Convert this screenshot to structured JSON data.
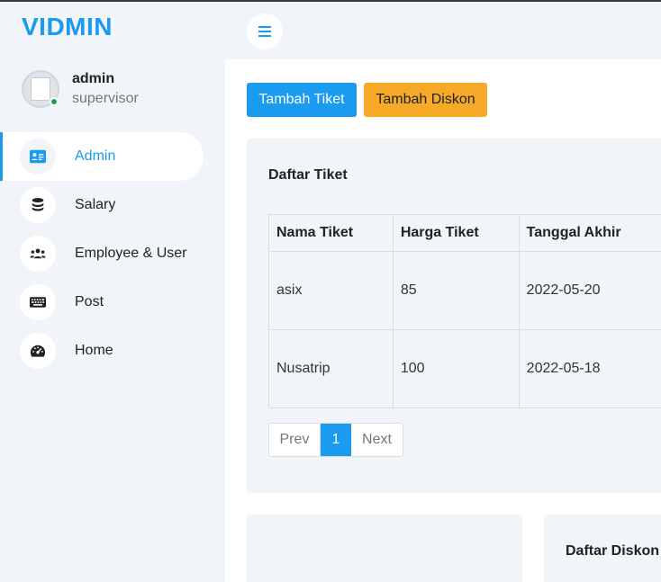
{
  "brand": "VIDMIN",
  "user": {
    "name": "admin",
    "role": "supervisor"
  },
  "sidebar": {
    "items": [
      {
        "label": "Admin",
        "icon": "id-card-icon",
        "active": true
      },
      {
        "label": "Salary",
        "icon": "coins-icon"
      },
      {
        "label": "Employee & User",
        "icon": "users-icon"
      },
      {
        "label": "Post",
        "icon": "keyboard-icon"
      },
      {
        "label": "Home",
        "icon": "dashboard-icon"
      }
    ]
  },
  "actions": {
    "add_ticket": "Tambah Tiket",
    "add_discount": "Tambah Diskon"
  },
  "tickets": {
    "title": "Daftar Tiket",
    "columns": [
      "Nama Tiket",
      "Harga Tiket",
      "Tanggal Akhir"
    ],
    "rows": [
      [
        "asix",
        "85",
        "2022-05-20"
      ],
      [
        "Nusatrip",
        "100",
        "2022-05-18"
      ]
    ]
  },
  "pagination": {
    "prev": "Prev",
    "current": "1",
    "next": "Next"
  },
  "discounts": {
    "title": "Daftar Diskon"
  },
  "colors": {
    "accent": "#1a9bf0",
    "warning": "#f7a928",
    "online": "#1f9d55"
  }
}
